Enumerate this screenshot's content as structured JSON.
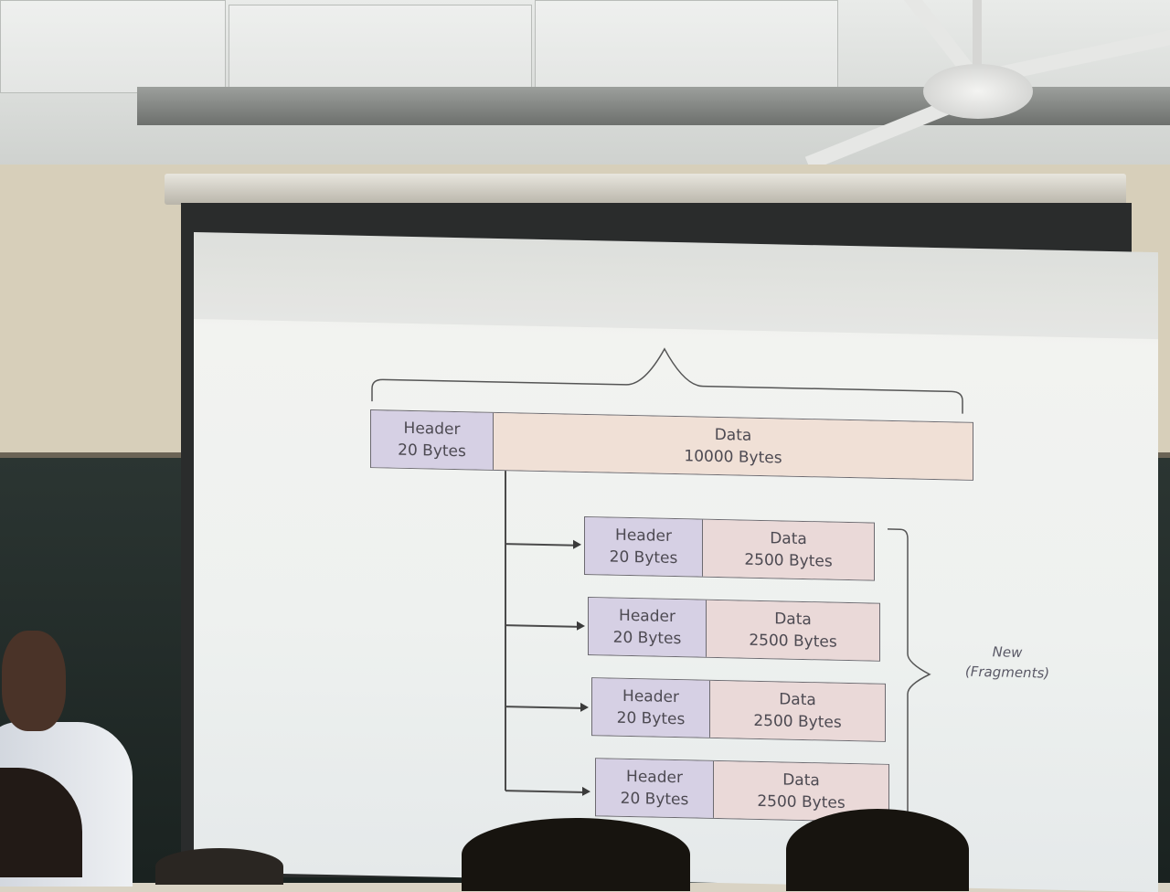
{
  "original_packet": {
    "header_label": "Header",
    "header_size": "20 Bytes",
    "data_label": "Data",
    "data_size": "10000 Bytes"
  },
  "fragments": [
    {
      "header_label": "Header",
      "header_size": "20 Bytes",
      "data_label": "Data",
      "data_size": "2500 Bytes"
    },
    {
      "header_label": "Header",
      "header_size": "20 Bytes",
      "data_label": "Data",
      "data_size": "2500 Bytes"
    },
    {
      "header_label": "Header",
      "header_size": "20 Bytes",
      "data_label": "Data",
      "data_size": "2500 Bytes"
    },
    {
      "header_label": "Header",
      "header_size": "20 Bytes",
      "data_label": "Data",
      "data_size": "2500 Bytes"
    }
  ],
  "fragments_label": {
    "line1": "New",
    "line2": "(Fragments)"
  },
  "colors": {
    "header_fill": "#d6d0e4",
    "data_fill": "#ead9d8",
    "screen": "#eef1ef",
    "text": "#4d4a52"
  }
}
